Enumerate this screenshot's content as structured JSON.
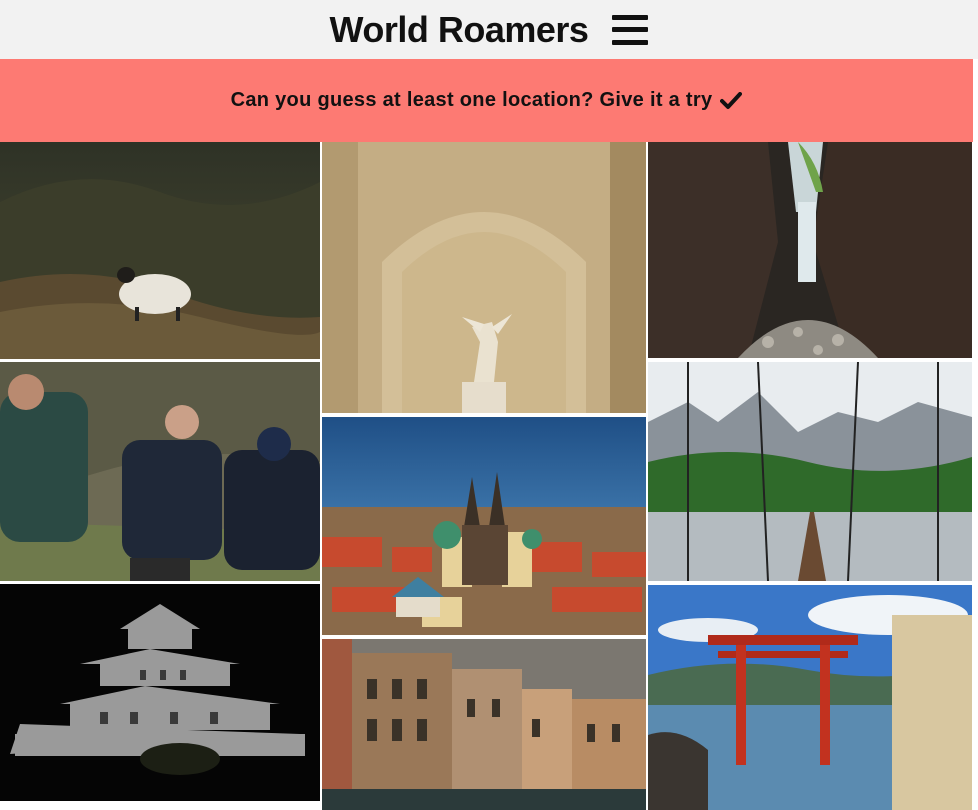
{
  "header": {
    "title": "World Roamers",
    "menu_icon": "hamburger-menu-icon"
  },
  "banner": {
    "text": "Can you guess at least one location? Give it a try",
    "icon": "checkmark-icon",
    "background": "#fd7a73"
  },
  "gallery": {
    "photos": [
      {
        "name": "photo-sheep-hillside"
      },
      {
        "name": "photo-winged-statue-niche"
      },
      {
        "name": "photo-gorge-waterfall"
      },
      {
        "name": "photo-three-travelers"
      },
      {
        "name": "photo-old-town-skyline"
      },
      {
        "name": "photo-suspension-bridge"
      },
      {
        "name": "photo-castle-at-night"
      },
      {
        "name": "photo-canal-buildings"
      },
      {
        "name": "photo-floating-torii-gate"
      }
    ]
  }
}
